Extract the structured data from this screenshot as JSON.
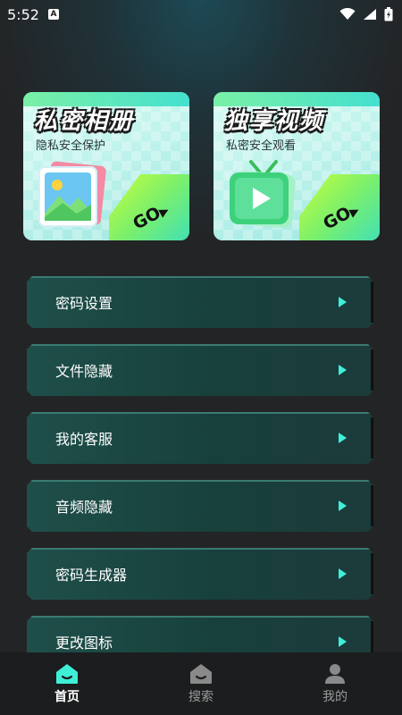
{
  "status_bar": {
    "time": "5:52",
    "notification_icon": "a-icon"
  },
  "cards": [
    {
      "title": "私密相册",
      "subtitle": "隐私安全保护",
      "go_label": "GO"
    },
    {
      "title": "独享视频",
      "subtitle": "私密安全观看",
      "go_label": "GO"
    }
  ],
  "menu": {
    "items": [
      {
        "label": "密码设置"
      },
      {
        "label": "文件隐藏"
      },
      {
        "label": "我的客服"
      },
      {
        "label": "音频隐藏"
      },
      {
        "label": "密码生成器"
      },
      {
        "label": "更改图标"
      }
    ]
  },
  "bottom_nav": {
    "items": [
      {
        "label": "首页",
        "icon": "home-icon",
        "active": true
      },
      {
        "label": "搜索",
        "icon": "search-house-icon",
        "active": false
      },
      {
        "label": "我的",
        "icon": "user-icon",
        "active": false
      }
    ]
  },
  "colors": {
    "accent": "#3ff0d8",
    "card_bg": "#b9f1ea",
    "go_wedge": "#c9ff3b",
    "menu_bg": "#1f4f4a",
    "page_bg": "#232425"
  }
}
